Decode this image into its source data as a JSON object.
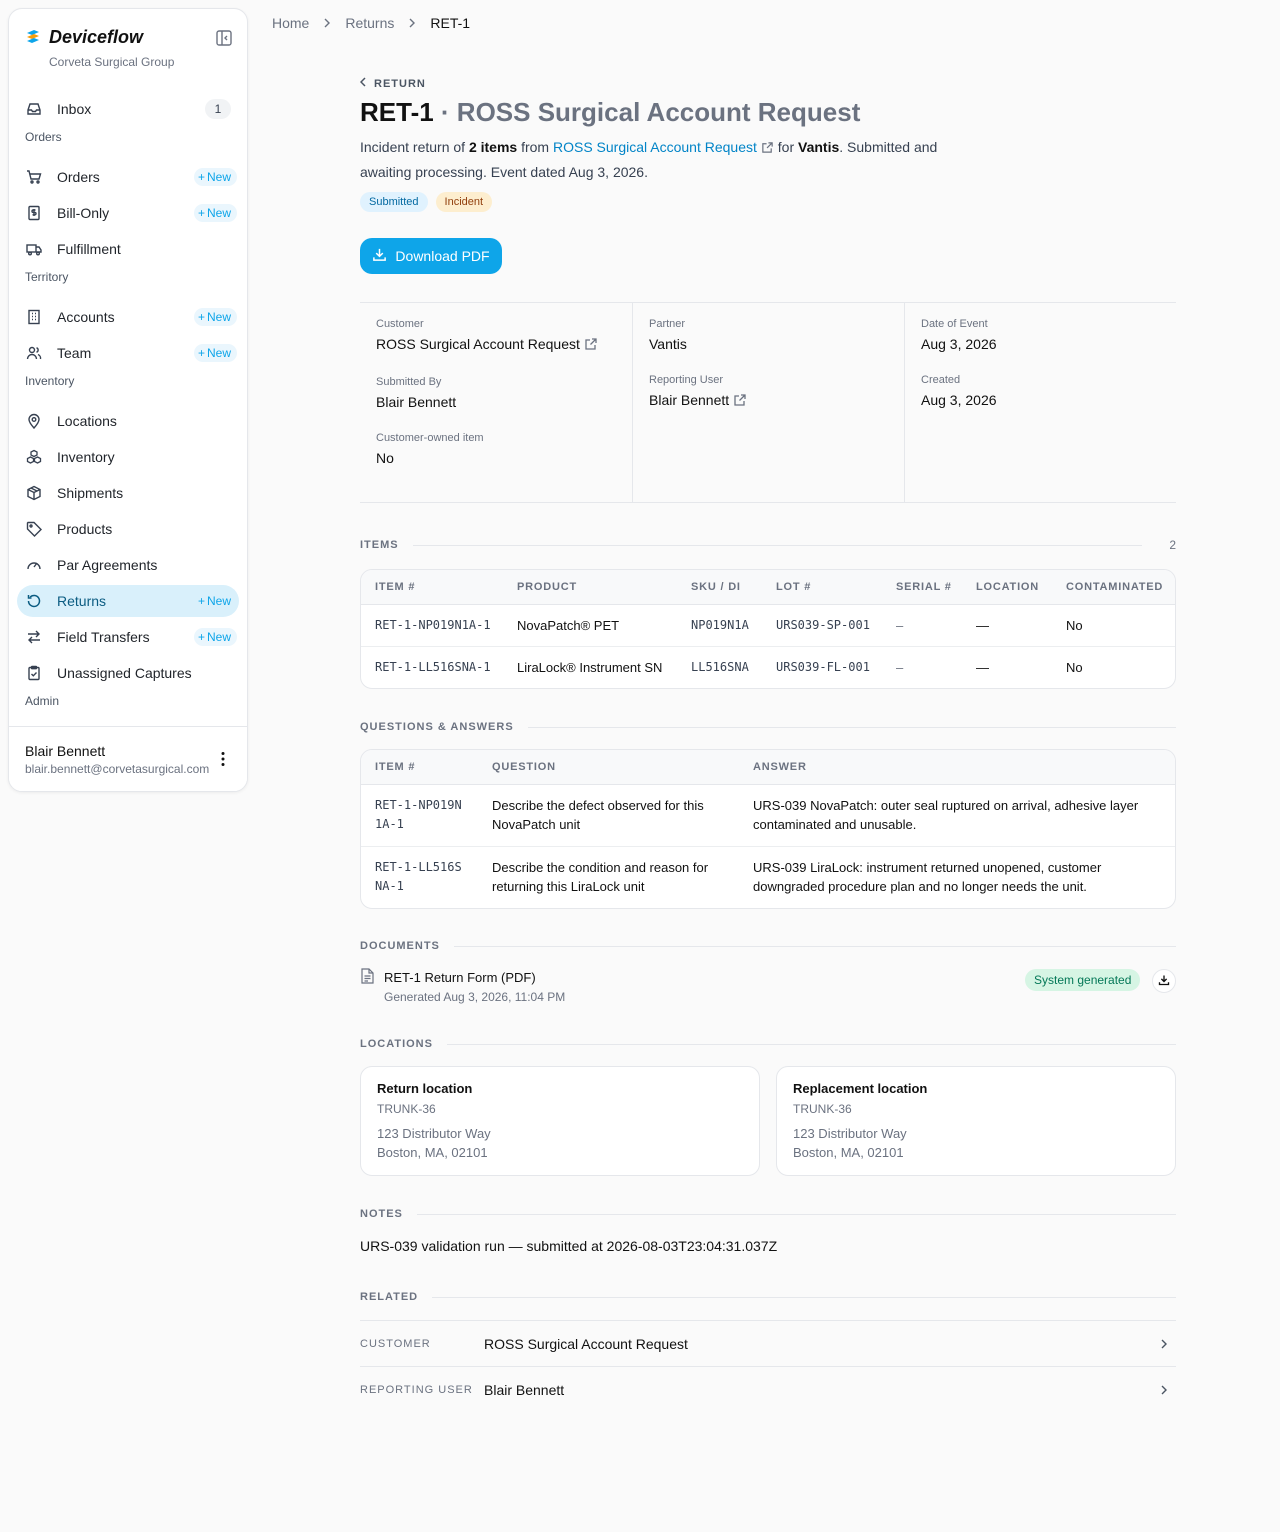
{
  "brand": {
    "name": "Deviceflow",
    "org": "Corveta Surgical Group"
  },
  "colors": {
    "accent": "#0ea5e9",
    "active_bg": "#d9f0fb",
    "success": "#047857"
  },
  "sidebar": {
    "inbox": {
      "label": "Inbox",
      "count": "1"
    },
    "sections": {
      "orders": "Orders",
      "territory": "Territory",
      "inventory": "Inventory",
      "admin": "Admin"
    },
    "new_label": "New",
    "items": {
      "orders": "Orders",
      "bill_only": "Bill-Only",
      "fulfillment": "Fulfillment",
      "accounts": "Accounts",
      "team": "Team",
      "locations": "Locations",
      "inventory": "Inventory",
      "shipments": "Shipments",
      "products": "Products",
      "par_agreements": "Par Agreements",
      "returns": "Returns",
      "field_transfers": "Field Transfers",
      "unassigned_captures": "Unassigned Captures"
    },
    "user": {
      "name": "Blair Bennett",
      "email": "blair.bennett@corvetasurgical.com"
    }
  },
  "breadcrumb": {
    "home": "Home",
    "returns": "Returns",
    "current": "RET-1"
  },
  "header": {
    "back_label": "RETURN",
    "id": "RET-1",
    "title_rest": "· ROSS Surgical Account Request",
    "summary": {
      "p1": "Incident return of ",
      "count": "2 items",
      "p2": " from ",
      "customer": "ROSS Surgical Account Request",
      "p3": " for ",
      "partner": "Vantis",
      "p4": ". Submitted and awaiting processing. Event dated Aug 3, 2026."
    },
    "tags": {
      "status": "Submitted",
      "type": "Incident"
    },
    "download_label": "Download PDF"
  },
  "details": {
    "customer": {
      "label": "Customer",
      "value": "ROSS Surgical Account Request"
    },
    "submitted_by": {
      "label": "Submitted By",
      "value": "Blair Bennett"
    },
    "customer_owned": {
      "label": "Customer-owned item",
      "value": "No"
    },
    "partner": {
      "label": "Partner",
      "value": "Vantis"
    },
    "reporting_user": {
      "label": "Reporting User",
      "value": "Blair Bennett"
    },
    "date_of_event": {
      "label": "Date of Event",
      "value": "Aug 3, 2026"
    },
    "created": {
      "label": "Created",
      "value": "Aug 3, 2026"
    }
  },
  "items": {
    "title": "ITEMS",
    "count": "2",
    "columns": [
      "ITEM #",
      "PRODUCT",
      "SKU / DI",
      "LOT #",
      "SERIAL #",
      "LOCATION",
      "CONTAMINATED"
    ],
    "rows": [
      [
        "RET-1-NP019N1A-1",
        "NovaPatch® PET",
        "NP019N1A",
        "URS039-SP-001",
        "–",
        "—",
        "No"
      ],
      [
        "RET-1-LL516SNA-1",
        "LiraLock® Instrument SN",
        "LL516SNA",
        "URS039-FL-001",
        "–",
        "—",
        "No"
      ]
    ]
  },
  "qa": {
    "title": "QUESTIONS & ANSWERS",
    "columns": [
      "ITEM #",
      "QUESTION",
      "ANSWER"
    ],
    "rows": [
      [
        "RET-1-NP019N1A-1",
        "Describe the defect observed for this NovaPatch unit",
        "URS-039 NovaPatch: outer seal ruptured on arrival, adhesive layer contaminated and unusable."
      ],
      [
        "RET-1-LL516SNA-1",
        "Describe the condition and reason for returning this LiraLock unit",
        "URS-039 LiraLock: instrument returned unopened, customer downgraded procedure plan and no longer needs the unit."
      ]
    ]
  },
  "documents": {
    "title": "DOCUMENTS",
    "name": "RET-1 Return Form (PDF)",
    "meta": "Generated Aug 3, 2026, 11:04 PM",
    "badge": "System generated"
  },
  "locations": {
    "title": "LOCATIONS",
    "return": {
      "title": "Return location",
      "code": "TRUNK-36",
      "line1": "123 Distributor Way",
      "line2": "Boston, MA, 02101"
    },
    "replacement": {
      "title": "Replacement location",
      "code": "TRUNK-36",
      "line1": "123 Distributor Way",
      "line2": "Boston, MA, 02101"
    }
  },
  "notes": {
    "title": "NOTES",
    "text": "URS-039 validation run — submitted at 2026-08-03T23:04:31.037Z"
  },
  "related": {
    "title": "RELATED",
    "customer": {
      "label": "CUSTOMER",
      "value": "ROSS Surgical Account Request"
    },
    "reporting_user": {
      "label": "REPORTING USER",
      "value": "Blair Bennett"
    }
  }
}
